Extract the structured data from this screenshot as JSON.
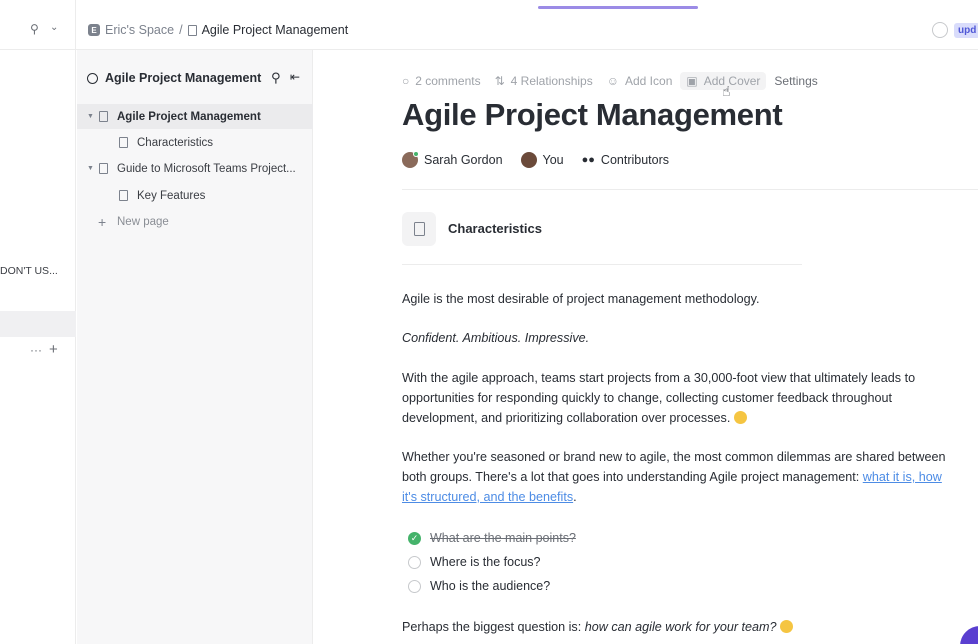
{
  "topbar": {
    "breadcrumb": {
      "space_initial": "E",
      "space": "Eric's Space",
      "separator": "/",
      "page": "Agile Project Management"
    },
    "update_badge": "upd"
  },
  "far_left": {
    "truncated_item": "DON'T US..."
  },
  "tree": {
    "header": "Agile Project Management",
    "items": [
      {
        "label": "Agile Project Management"
      },
      {
        "label": "Characteristics"
      },
      {
        "label": "Guide to Microsoft Teams Project..."
      },
      {
        "label": "Key Features"
      },
      {
        "label": "New page"
      }
    ]
  },
  "doc": {
    "actions": {
      "comments": "2 comments",
      "relationships": "4 Relationships",
      "add_icon": "Add Icon",
      "add_cover": "Add Cover",
      "settings": "Settings"
    },
    "title": "Agile Project Management",
    "people": {
      "author": "Sarah Gordon",
      "you": "You",
      "contributors": "Contributors"
    },
    "subpage": "Characteristics",
    "paragraphs": {
      "p1": "Agile is the most desirable of project management methodology.",
      "p2": "Confident. Ambitious. Impressive.",
      "p3_l1": "With the agile approach, teams start projects from a 30,000-foot view that ultimately leads to",
      "p3_l2": "opportunities for responding quickly to change, collecting customer feedback throughout",
      "p3_l3": "development, and prioritizing collaboration over processes.",
      "p4_l1": "Whether you're seasoned or brand new to agile, the most common dilemmas are shared between",
      "p4_l2": "both groups. There's a lot that goes into understanding Agile project management: ",
      "p4_link1": "what it is, how",
      "p4_link2": "it's structured, and the benefits",
      "p4_end": ".",
      "p5_start": "Perhaps the biggest question is: ",
      "p5_italic": "how can agile work for your team?"
    },
    "checklist": [
      {
        "text": "What are the main points?",
        "checked": true
      },
      {
        "text": "Where is the focus?",
        "checked": false
      },
      {
        "text": "Who is the audience?",
        "checked": false
      }
    ]
  },
  "colors": {
    "accent": "#9b8be6",
    "link": "#4d8ce5",
    "check_done": "#45b36b",
    "badge": "#4f57d6"
  }
}
